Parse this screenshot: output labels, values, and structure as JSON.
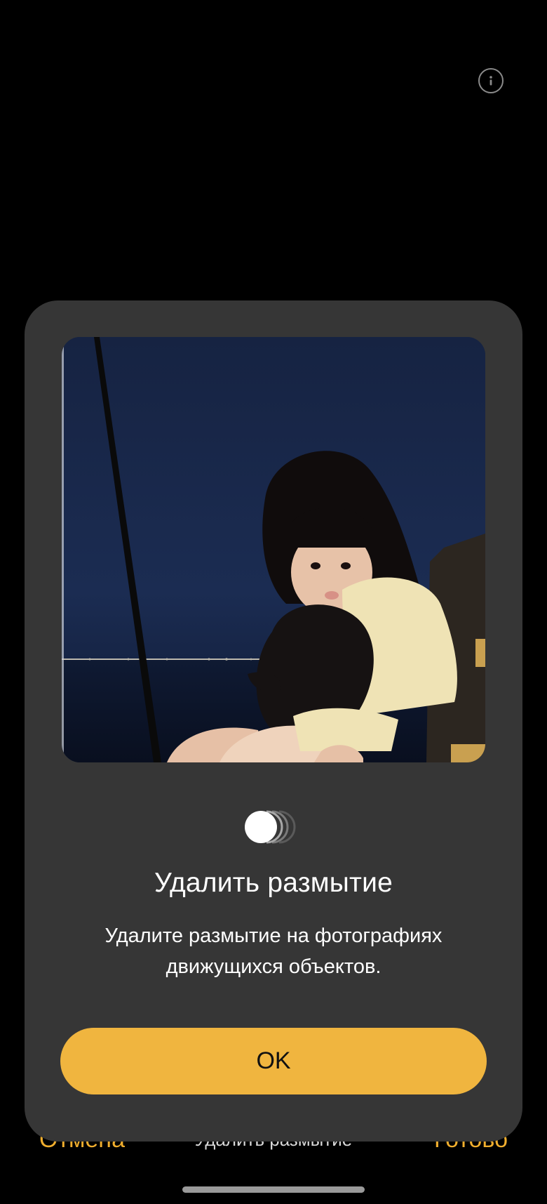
{
  "top_bar": {
    "info_icon": "info-icon"
  },
  "bottom_bar": {
    "cancel_label": "Отмена",
    "title": "Удалить размытие",
    "done_label": "Готово",
    "accent_color": "#f0ae2e"
  },
  "dialog": {
    "image_description_icon": "photo",
    "feature_icon": "motion-blur-icon",
    "title": "Удалить размытие",
    "description": "Удалите размытие на фотографиях движущихся объектов.",
    "ok_label": "OK",
    "button_color": "#f0b53f",
    "background_color": "#363636"
  }
}
